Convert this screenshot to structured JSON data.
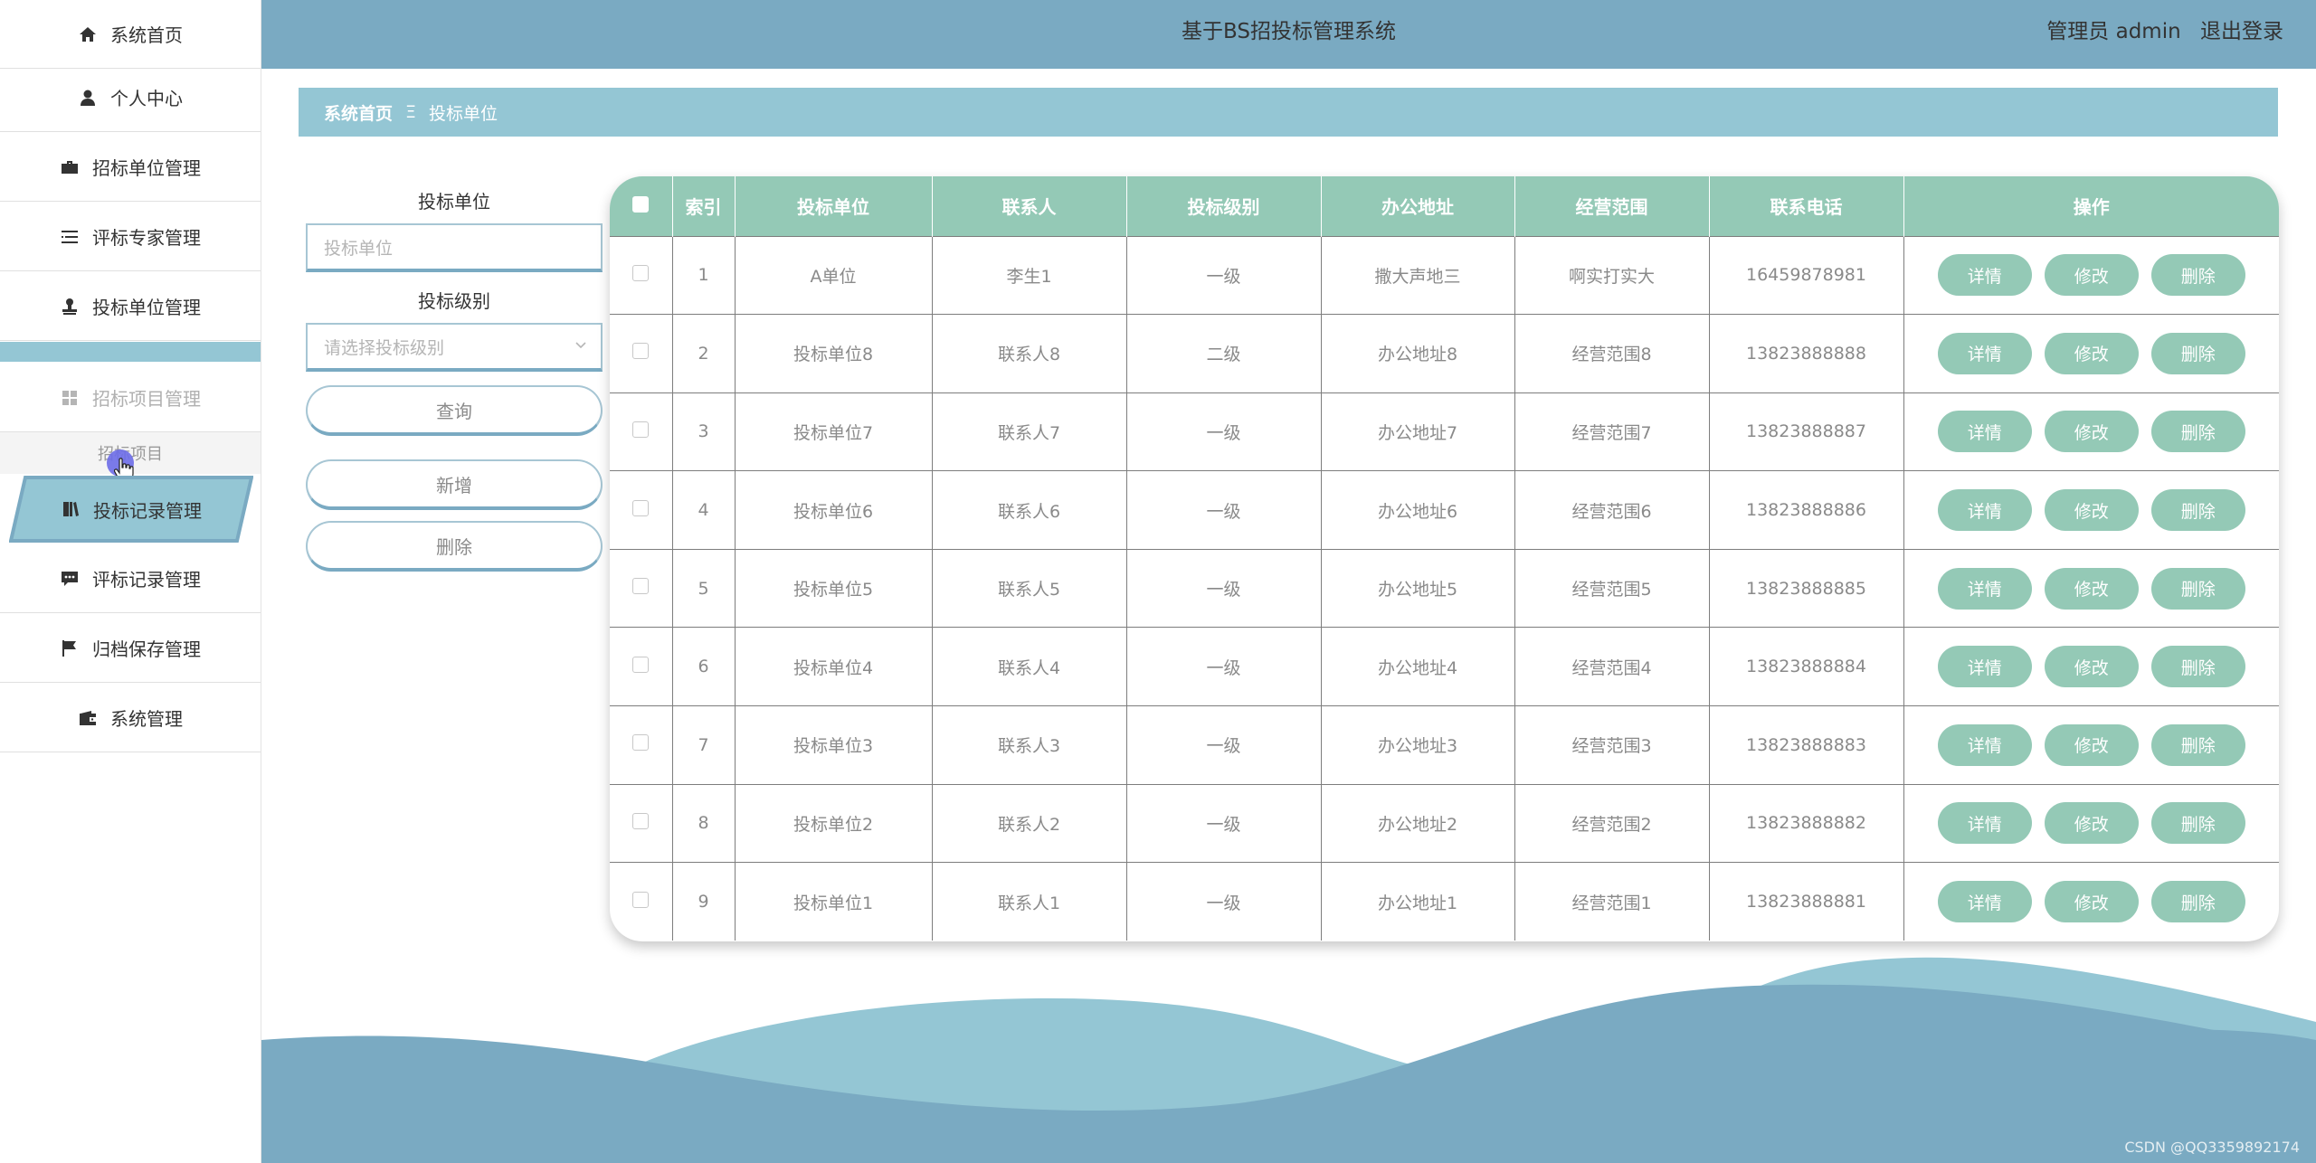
{
  "header": {
    "title": "基于BS招投标管理系统",
    "user_label": "管理员 admin",
    "logout_label": "退出登录"
  },
  "sidebar": {
    "items": [
      {
        "label": "系统首页",
        "icon": "home-icon"
      },
      {
        "label": "个人中心",
        "icon": "user-icon"
      },
      {
        "label": "招标单位管理",
        "icon": "briefcase-icon"
      },
      {
        "label": "评标专家管理",
        "icon": "list-icon"
      },
      {
        "label": "投标单位管理",
        "icon": "stamp-icon"
      },
      {
        "label": "招标项目管理",
        "icon": "grid-icon"
      },
      {
        "label": "投标记录管理",
        "icon": "book-icon"
      },
      {
        "label": "评标记录管理",
        "icon": "comment-icon"
      },
      {
        "label": "归档保存管理",
        "icon": "flag-icon"
      },
      {
        "label": "系统管理",
        "icon": "wallet-icon"
      }
    ],
    "submenu_label": "招标项目"
  },
  "breadcrumb": {
    "home": "系统首页",
    "separator": "Ξ",
    "current": "投标单位"
  },
  "search": {
    "unit_label": "投标单位",
    "unit_placeholder": "投标单位",
    "level_label": "投标级别",
    "level_placeholder": "请选择投标级别",
    "query_button": "查询",
    "add_button": "新增",
    "delete_button": "删除"
  },
  "table": {
    "headers": [
      "索引",
      "投标单位",
      "联系人",
      "投标级别",
      "办公地址",
      "经营范围",
      "联系电话",
      "操作"
    ],
    "rows": [
      {
        "index": "1",
        "unit": "A单位",
        "contact": "李生1",
        "level": "一级",
        "address": "撒大声地三",
        "scope": "啊实打实大",
        "phone": "16459878981"
      },
      {
        "index": "2",
        "unit": "投标单位8",
        "contact": "联系人8",
        "level": "二级",
        "address": "办公地址8",
        "scope": "经营范围8",
        "phone": "13823888888"
      },
      {
        "index": "3",
        "unit": "投标单位7",
        "contact": "联系人7",
        "level": "一级",
        "address": "办公地址7",
        "scope": "经营范围7",
        "phone": "13823888887"
      },
      {
        "index": "4",
        "unit": "投标单位6",
        "contact": "联系人6",
        "level": "一级",
        "address": "办公地址6",
        "scope": "经营范围6",
        "phone": "13823888886"
      },
      {
        "index": "5",
        "unit": "投标单位5",
        "contact": "联系人5",
        "level": "一级",
        "address": "办公地址5",
        "scope": "经营范围5",
        "phone": "13823888885"
      },
      {
        "index": "6",
        "unit": "投标单位4",
        "contact": "联系人4",
        "level": "一级",
        "address": "办公地址4",
        "scope": "经营范围4",
        "phone": "13823888884"
      },
      {
        "index": "7",
        "unit": "投标单位3",
        "contact": "联系人3",
        "level": "一级",
        "address": "办公地址3",
        "scope": "经营范围3",
        "phone": "13823888883"
      },
      {
        "index": "8",
        "unit": "投标单位2",
        "contact": "联系人2",
        "level": "一级",
        "address": "办公地址2",
        "scope": "经营范围2",
        "phone": "13823888882"
      },
      {
        "index": "9",
        "unit": "投标单位1",
        "contact": "联系人1",
        "level": "一级",
        "address": "办公地址1",
        "scope": "经营范围1",
        "phone": "13823888881"
      }
    ],
    "actions": {
      "detail": "详情",
      "edit": "修改",
      "delete": "删除"
    }
  },
  "watermark": "CSDN @QQ3359892174",
  "colors": {
    "header_bg": "#7aaac2",
    "breadcrumb_bg": "#94c6d4",
    "table_header_bg": "#94c9b6",
    "button_bg": "#94c9b6",
    "wave_light": "#94c6d4",
    "wave_dark": "#7aaac2"
  }
}
